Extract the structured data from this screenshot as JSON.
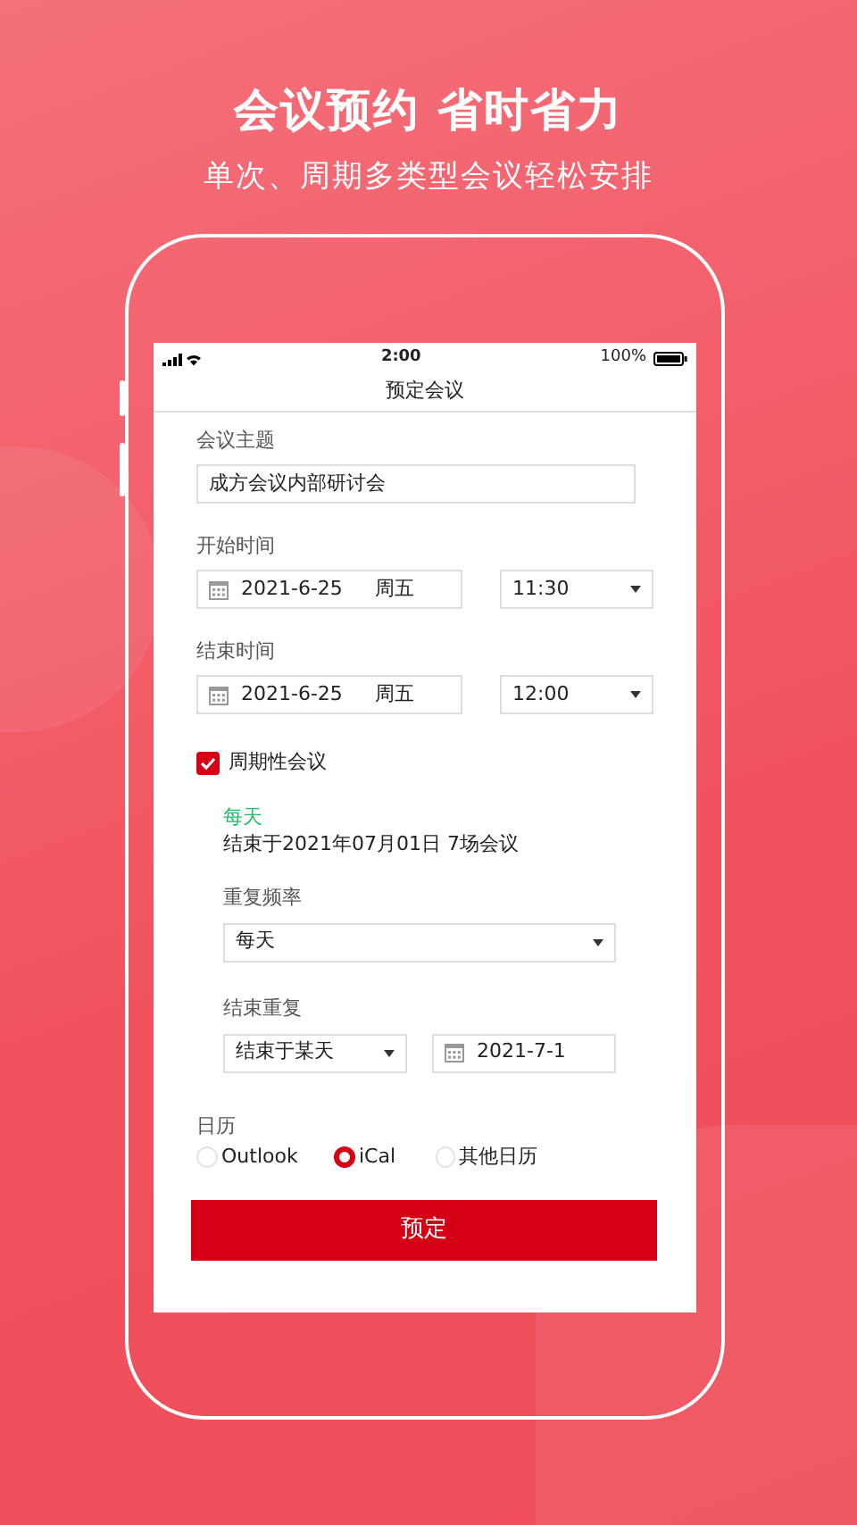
{
  "headline": "会议预约 省时省力",
  "subheadline": "单次、周期多类型会议轻松安排",
  "status_bar": {
    "time": "2:00",
    "battery": "100%"
  },
  "screen_title": "预定会议",
  "topic": {
    "label": "会议主题",
    "value": "成方会议内部研讨会"
  },
  "start": {
    "label": "开始时间",
    "date": "2021-6-25",
    "weekday": "周五",
    "time": "11:30"
  },
  "end": {
    "label": "结束时间",
    "date": "2021-6-25",
    "weekday": "周五",
    "time": "12:00"
  },
  "recurring": {
    "label": "周期性会议",
    "checked": true,
    "summary_title": "每天",
    "summary": "结束于2021年07月01日 7场会议",
    "frequency_label": "重复频率",
    "frequency": "每天",
    "end_label": "结束重复",
    "end_mode": "结束于某天",
    "end_date": "2021-7-1"
  },
  "calendar": {
    "label": "日历",
    "options": [
      {
        "label": "Outlook",
        "selected": false
      },
      {
        "label": "iCal",
        "selected": true
      },
      {
        "label": "其他日历",
        "selected": false
      }
    ]
  },
  "submit": "预定"
}
